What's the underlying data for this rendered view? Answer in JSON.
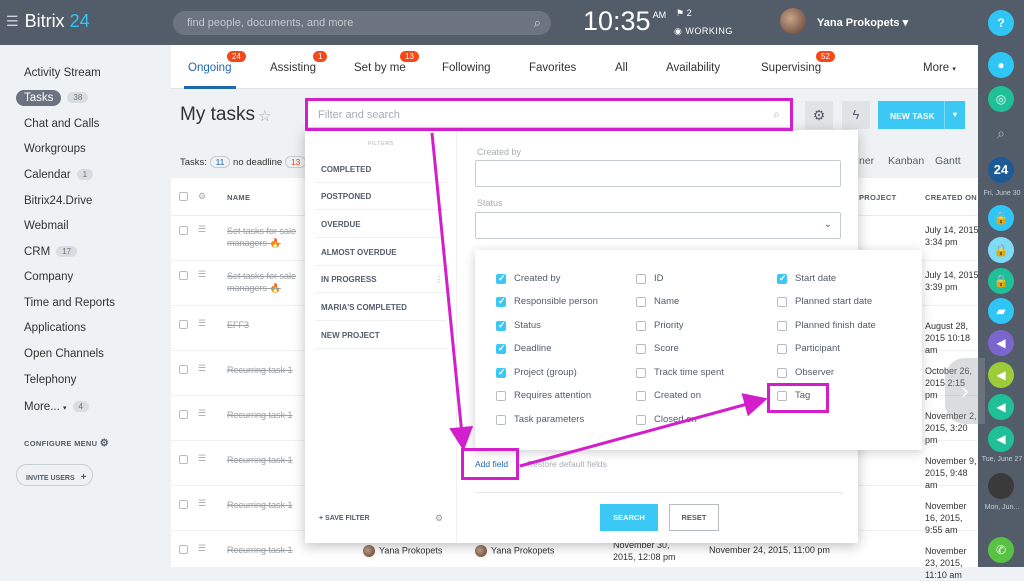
{
  "app": {
    "logo_prefix": "Bitrix",
    "logo_suffix": "24"
  },
  "topbar": {
    "search_placeholder": "find people, documents, and more",
    "time": "10:35",
    "ampm": "AM",
    "flag_count": "2",
    "status": "WORKING",
    "user": "Yana Prokopets"
  },
  "sidebar": {
    "items": [
      {
        "label": "Activity Stream",
        "count": ""
      },
      {
        "label": "Tasks",
        "count": "38"
      },
      {
        "label": "Chat and Calls",
        "count": ""
      },
      {
        "label": "Workgroups",
        "count": ""
      },
      {
        "label": "Calendar",
        "count": "1"
      },
      {
        "label": "Bitrix24.Drive",
        "count": ""
      },
      {
        "label": "Webmail",
        "count": ""
      },
      {
        "label": "CRM",
        "count": "17"
      },
      {
        "label": "Company",
        "count": ""
      },
      {
        "label": "Time and Reports",
        "count": ""
      },
      {
        "label": "Applications",
        "count": ""
      },
      {
        "label": "Open Channels",
        "count": ""
      },
      {
        "label": "Telephony",
        "count": ""
      },
      {
        "label": "More...",
        "count": "4"
      }
    ],
    "configure_menu": "CONFIGURE MENU",
    "invite_users": "INVITE USERS"
  },
  "tabs": [
    {
      "label": "Ongoing",
      "badge": "24"
    },
    {
      "label": "Assisting",
      "badge": "1"
    },
    {
      "label": "Set by me",
      "badge": "13"
    },
    {
      "label": "Following",
      "badge": ""
    },
    {
      "label": "Favorites",
      "badge": ""
    },
    {
      "label": "All",
      "badge": ""
    },
    {
      "label": "Availability",
      "badge": ""
    },
    {
      "label": "Supervising",
      "badge": "52"
    },
    {
      "label": "More",
      "badge": ""
    }
  ],
  "page": {
    "title": "My tasks",
    "filter_placeholder": "Filter and search",
    "new_task": "NEW TASK",
    "tasks_label": "Tasks:",
    "tasks_count": "11",
    "no_deadline": "no deadline",
    "no_deadline_count": "13",
    "views": [
      "ner",
      "Kanban",
      "Gantt"
    ]
  },
  "table": {
    "headers": {
      "name": "NAME",
      "project": "PROJECT",
      "created_on": "CREATED ON"
    },
    "rows": [
      {
        "name": "Set tasks for sale managers",
        "created": "July 14, 2015 3:34 pm"
      },
      {
        "name": "Set tasks for sale managers",
        "created": "July 14, 2015 3:39 pm"
      },
      {
        "name": "EFF3",
        "created": "August 28, 2015 10:18 am"
      },
      {
        "name": "Recurring task 1",
        "created": "October 26, 2015 2:15 pm"
      },
      {
        "name": "Recurring task 1",
        "created": "November 2, 2015, 3:20 pm"
      },
      {
        "name": "Recurring task 1",
        "created": "November 9, 2015, 9:48 am"
      },
      {
        "name": "Recurring task 1",
        "created": "November 16, 2015, 9:55 am"
      },
      {
        "name": "Recurring task 1",
        "created": "November 23, 2015, 11:10 am"
      }
    ],
    "last_row": {
      "responsible": "Yana Prokopets",
      "creator": "Yana Prokopets",
      "deadline": "November 30, 2015, 12:08 pm",
      "changed": "November 24, 2015, 11:00 pm"
    }
  },
  "filter_popup": {
    "filters_header": "FILTERS",
    "presets": [
      "COMPLETED",
      "POSTPONED",
      "OVERDUE",
      "ALMOST OVERDUE",
      "IN PROGRESS",
      "MARIA'S COMPLETED",
      "NEW PROJECT"
    ],
    "save_filter": "SAVE FILTER",
    "created_by_label": "Created by",
    "status_label": "Status",
    "add_field": "Add field",
    "restore": "Restore default fields",
    "search": "SEARCH",
    "reset": "RESET"
  },
  "fields": {
    "col1": [
      {
        "label": "Created by",
        "checked": true
      },
      {
        "label": "Responsible person",
        "checked": true
      },
      {
        "label": "Status",
        "checked": true
      },
      {
        "label": "Deadline",
        "checked": true
      },
      {
        "label": "Project (group)",
        "checked": true
      },
      {
        "label": "Requires attention",
        "checked": false
      },
      {
        "label": "Task parameters",
        "checked": false
      }
    ],
    "col2": [
      {
        "label": "ID",
        "checked": false
      },
      {
        "label": "Name",
        "checked": false
      },
      {
        "label": "Priority",
        "checked": false
      },
      {
        "label": "Score",
        "checked": false
      },
      {
        "label": "Track time spent",
        "checked": false
      },
      {
        "label": "Created on",
        "checked": false
      },
      {
        "label": "Closed on",
        "checked": false
      }
    ],
    "col3": [
      {
        "label": "Start date",
        "checked": true
      },
      {
        "label": "Planned start date",
        "checked": false
      },
      {
        "label": "Planned finish date",
        "checked": false
      },
      {
        "label": "Participant",
        "checked": false
      },
      {
        "label": "Observer",
        "checked": false
      },
      {
        "label": "Tag",
        "checked": false
      }
    ]
  },
  "right_panel": {
    "date1": "Fri, June 30",
    "date2": "Tue, June 27",
    "date3": "Mon, Jun..."
  },
  "colors": {
    "accent": "#2067b0",
    "highlight": "#d21fcb",
    "button": "#3bc8f5",
    "badge": "#f54819",
    "topbar": "#535c69"
  }
}
